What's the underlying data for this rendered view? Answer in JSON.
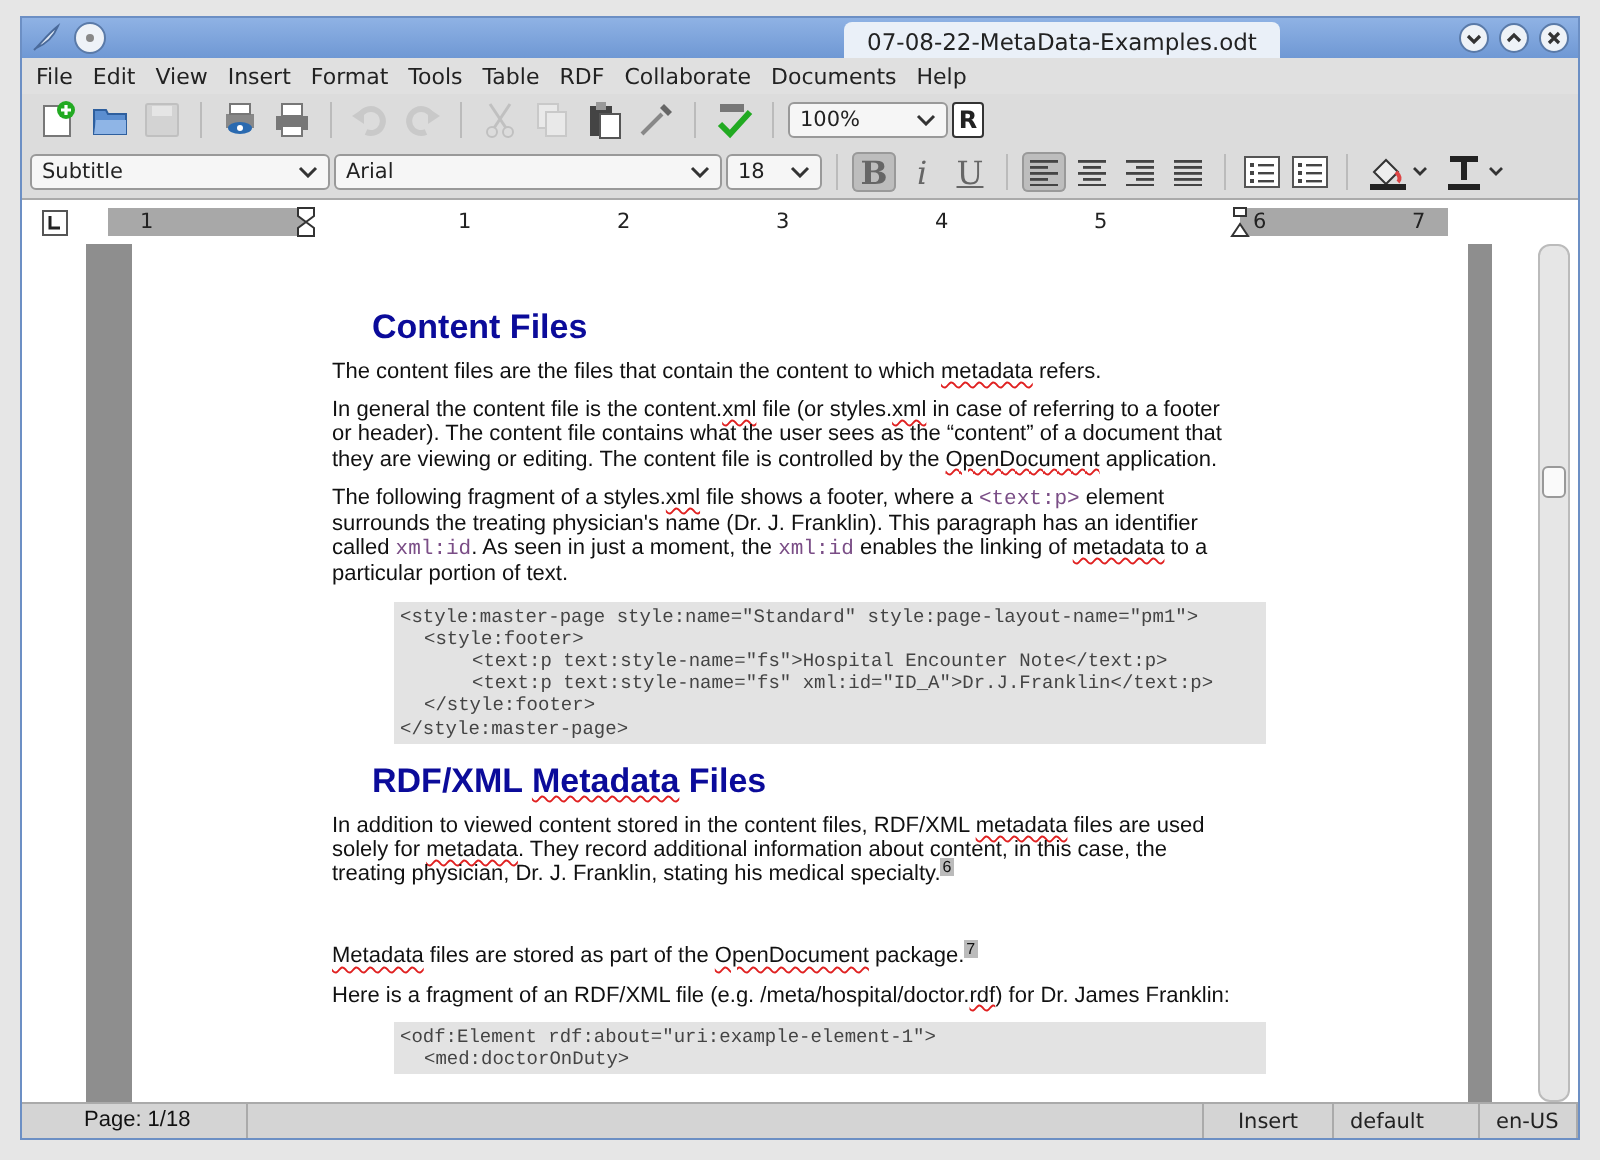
{
  "window": {
    "title": "07-08-22-MetaData-Examples.odt"
  },
  "menu": [
    "File",
    "Edit",
    "View",
    "Insert",
    "Format",
    "Tools",
    "Table",
    "RDF",
    "Collaborate",
    "Documents",
    "Help"
  ],
  "toolbar": [
    {
      "kind": "new",
      "disabled": false
    },
    {
      "kind": "open",
      "disabled": false
    },
    {
      "kind": "save",
      "disabled": true
    },
    {
      "kind": "sep"
    },
    {
      "kind": "preview",
      "disabled": false
    },
    {
      "kind": "print",
      "disabled": false
    },
    {
      "kind": "sep"
    },
    {
      "kind": "undo",
      "disabled": true
    },
    {
      "kind": "redo",
      "disabled": true
    },
    {
      "kind": "sep"
    },
    {
      "kind": "cut",
      "disabled": true
    },
    {
      "kind": "copy",
      "disabled": true
    },
    {
      "kind": "paste",
      "disabled": false
    },
    {
      "kind": "eyedropper",
      "disabled": false
    },
    {
      "kind": "sep"
    },
    {
      "kind": "spell",
      "disabled": false
    },
    {
      "kind": "sep"
    },
    {
      "kind": "zoom",
      "value": "100%"
    },
    {
      "kind": "letter",
      "label": "R"
    }
  ],
  "format_bar": {
    "style": "Subtitle",
    "font": "Arial",
    "size": "18",
    "buttons": [
      {
        "kind": "bold",
        "label": "B",
        "selected": true
      },
      {
        "kind": "italic",
        "label": "i",
        "selected": false
      },
      {
        "kind": "underline",
        "label": "U",
        "selected": false
      },
      {
        "kind": "sep"
      },
      {
        "kind": "align-left",
        "selected": true
      },
      {
        "kind": "align-center",
        "selected": false
      },
      {
        "kind": "align-right",
        "selected": false
      },
      {
        "kind": "justify",
        "selected": false
      },
      {
        "kind": "sep"
      },
      {
        "kind": "numbered-list",
        "selected": false
      },
      {
        "kind": "bullet-list",
        "selected": false
      },
      {
        "kind": "sep"
      },
      {
        "kind": "fill",
        "selected": false
      },
      {
        "kind": "text-color",
        "selected": false
      }
    ]
  },
  "ruler": {
    "labels": [
      "1",
      "1",
      "2",
      "3",
      "4",
      "5",
      "6",
      "7"
    ]
  },
  "document": [
    {
      "kind": "heading",
      "runs": [
        {
          "kind": "plain",
          "text": "Content Files"
        }
      ]
    },
    {
      "kind": "para",
      "runs": [
        {
          "kind": "plain",
          "text": "The content files are the files that contain the content to which "
        },
        {
          "kind": "spell",
          "text": "metadata"
        },
        {
          "kind": "plain",
          "text": " refers."
        }
      ]
    },
    {
      "kind": "para",
      "runs": [
        {
          "kind": "plain",
          "text": "In general the content file is the content."
        },
        {
          "kind": "spell",
          "text": "xml"
        },
        {
          "kind": "plain",
          "text": " file (or styles."
        },
        {
          "kind": "spell",
          "text": "xml"
        },
        {
          "kind": "plain",
          "text": " in case of referring to a footer or header). The content file contains what the user sees as the “content” of a document that they are viewing or editing. The content file is controlled by the "
        },
        {
          "kind": "spell",
          "text": "OpenDocument"
        },
        {
          "kind": "plain",
          "text": " application."
        }
      ]
    },
    {
      "kind": "para",
      "runs": [
        {
          "kind": "plain",
          "text": "The following fragment of a styles."
        },
        {
          "kind": "spell",
          "text": "xml"
        },
        {
          "kind": "plain",
          "text": " file shows a footer, where a "
        },
        {
          "kind": "code",
          "text": "<text:p>"
        },
        {
          "kind": "plain",
          "text": " element surrounds the treating physician's name (Dr. J. Franklin). This paragraph has an identifier called "
        },
        {
          "kind": "code",
          "text": "xml:id"
        },
        {
          "kind": "plain",
          "text": ". As seen in just a moment, the "
        },
        {
          "kind": "code",
          "text": "xml:id"
        },
        {
          "kind": "plain",
          "text": " enables the linking of "
        },
        {
          "kind": "spell",
          "text": "metadata"
        },
        {
          "kind": "plain",
          "text": " to a particular portion of text."
        }
      ]
    },
    {
      "kind": "code",
      "lines": [
        {
          "text": "<style:master-page style:name=\"Standard\" style:page-layout-name=\"pm1\">",
          "children": [
            {
              "text": "<style:footer>",
              "children": [
                {
                  "text": "<text:p text:style-name=\"fs\">Hospital Encounter Note</text:p>"
                },
                {
                  "text": "<text:p text:style-name=\"fs\" xml:id=\"ID_A\">Dr.J.Franklin</text:p>"
                }
              ]
            },
            {
              "text": "</style:footer>"
            }
          ]
        },
        {
          "text": "</style:master-page>"
        }
      ]
    },
    {
      "kind": "heading",
      "runs": [
        {
          "kind": "plain",
          "text": "RDF/XML "
        },
        {
          "kind": "spell",
          "text": "Metadata"
        },
        {
          "kind": "plain",
          "text": " Files"
        }
      ]
    },
    {
      "kind": "para",
      "runs": [
        {
          "kind": "plain",
          "text": "In addition to viewed content stored in the content files, RDF/XML "
        },
        {
          "kind": "spell",
          "text": "metadata"
        },
        {
          "kind": "plain",
          "text": " files are used solely for "
        },
        {
          "kind": "spell",
          "text": "metadata"
        },
        {
          "kind": "plain",
          "text": ". They record additional information about content, in this case, the treating physician, Dr. J. Franklin, stating his medical specialty."
        },
        {
          "kind": "footnote",
          "text": "6"
        }
      ]
    },
    {
      "kind": "blank"
    },
    {
      "kind": "para",
      "runs": [
        {
          "kind": "spell",
          "text": "Metadata"
        },
        {
          "kind": "plain",
          "text": " files are stored as part of the "
        },
        {
          "kind": "spell",
          "text": "OpenDocument"
        },
        {
          "kind": "plain",
          "text": " package."
        },
        {
          "kind": "footnote",
          "text": "7"
        }
      ]
    },
    {
      "kind": "para",
      "runs": [
        {
          "kind": "plain",
          "text": "Here is a fragment of an RDF/XML file (e.g. /meta/hospital/doctor."
        },
        {
          "kind": "spell",
          "text": "rdf"
        },
        {
          "kind": "plain",
          "text": ") for Dr. James Franklin:"
        }
      ]
    },
    {
      "kind": "code",
      "lines": [
        {
          "text": "<odf:Element rdf:about=\"uri:example-element-1\">",
          "children": [
            {
              "text": "<med:doctorOnDuty>"
            }
          ]
        }
      ]
    }
  ],
  "status_bar": {
    "page": "Page: 1/18",
    "mode": "Insert",
    "style": "default",
    "language": "en-US"
  }
}
